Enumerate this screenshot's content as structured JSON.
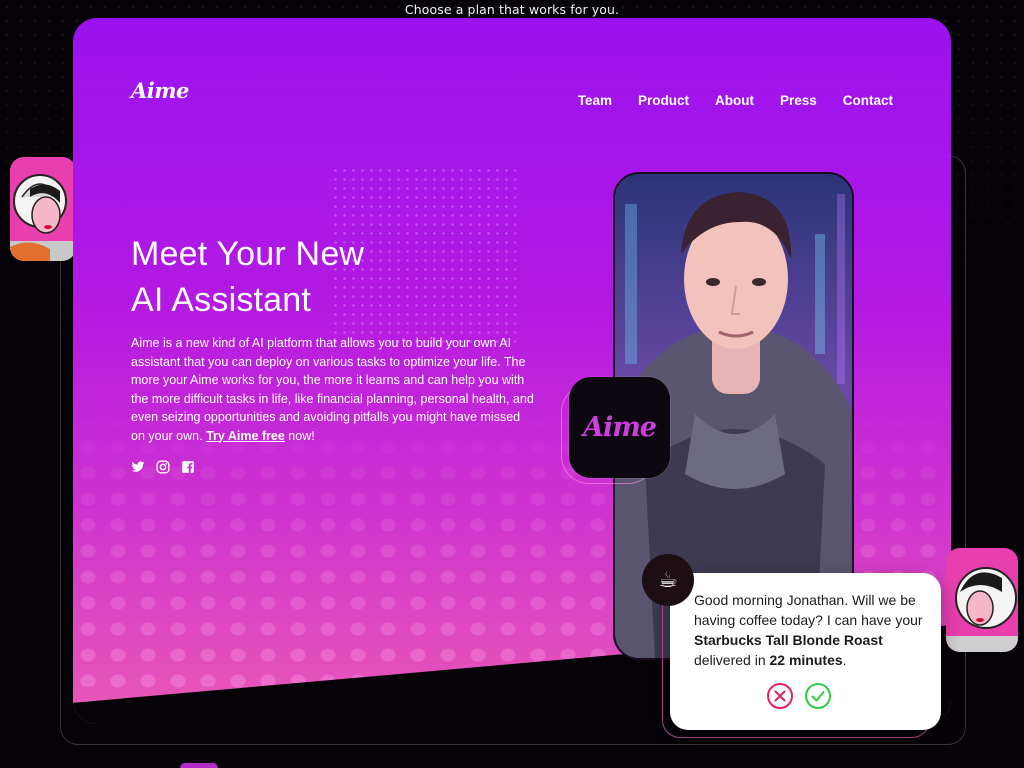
{
  "top_caption": "Choose a plan that works for you.",
  "brand": {
    "logo": "Aime",
    "app_badge": "Aime"
  },
  "nav": {
    "items": [
      {
        "label": "Team"
      },
      {
        "label": "Product"
      },
      {
        "label": "About"
      },
      {
        "label": "Press"
      },
      {
        "label": "Contact"
      }
    ]
  },
  "hero": {
    "headline_line1": "Meet Your New",
    "headline_line2": "AI Assistant",
    "description": "Aime is a new kind of AI platform that allows you to build your own AI assistant that you can deploy on various tasks to optimize your life. The more your Aime works for you, the more it learns and can help you with the more difficult tasks in life, like financial planning, personal health, and even seizing opportunities and avoiding pitfalls you might have missed on your own.",
    "cta_link": "Try Aime free",
    "cta_suffix": "now!"
  },
  "socials": [
    {
      "icon": "twitter-icon"
    },
    {
      "icon": "instagram-icon"
    },
    {
      "icon": "facebook-icon"
    }
  ],
  "chat": {
    "icon": "coffee-cup-icon",
    "text_part1": "Good morning Jonathan. Will we be having coffee today? I can have your",
    "product": "Starbucks Tall Blonde Roast",
    "text_part2": "delivered in",
    "eta": "22 minutes",
    "text_part3": ".",
    "decline_icon": "decline-x-icon",
    "accept_icon": "accept-check-icon"
  },
  "colors": {
    "hero_top": "#9a12f0",
    "hero_bottom": "#ea5ab6",
    "decline": "#e0245e",
    "accept": "#2ecc40",
    "badge_text": "#d13ee0"
  }
}
